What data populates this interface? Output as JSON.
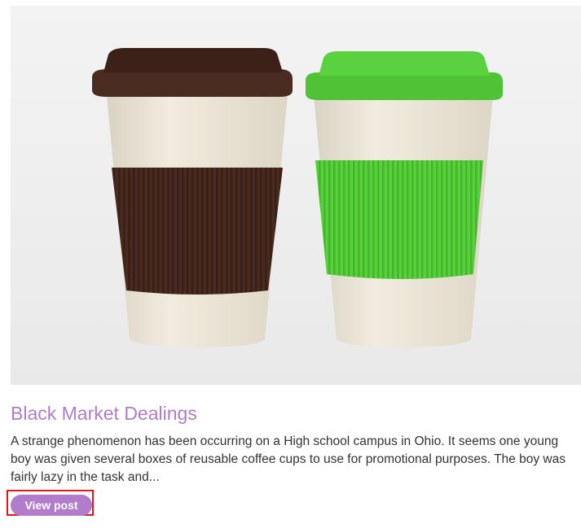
{
  "post": {
    "image_alt": "Two reusable coffee cups with brown and green lids and sleeves",
    "title": "Black Market Dealings",
    "summary": "A strange phenomenon has been occurring on a High school campus in Ohio. It seems one young boy was given several boxes of reusable coffee cups to use for promotional purposes. The boy was fairly lazy in the task and...",
    "view_post_label": "View post"
  },
  "colors": {
    "accent": "#b17ccb",
    "highlight_border": "#e8141b",
    "text": "#333333"
  }
}
